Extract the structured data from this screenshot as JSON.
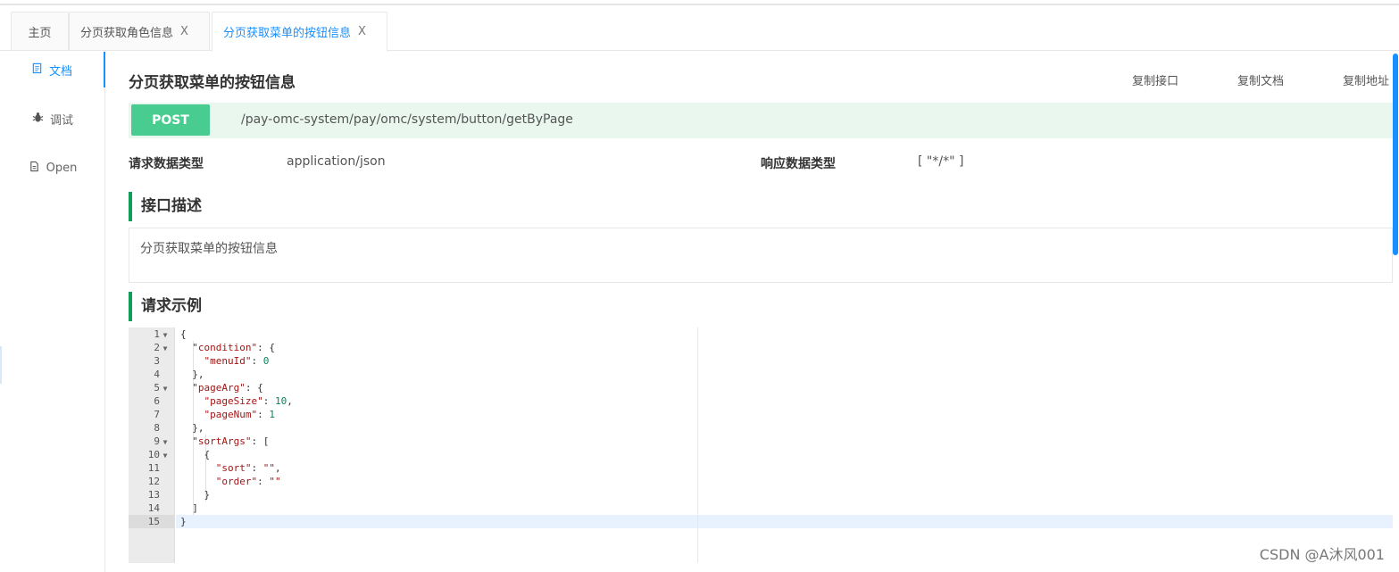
{
  "tabs": [
    {
      "label": "主页",
      "closable": false,
      "active": false
    },
    {
      "label": "分页获取角色信息",
      "closable": true,
      "active": false
    },
    {
      "label": "分页获取菜单的按钮信息",
      "closable": true,
      "active": true
    }
  ],
  "tab_close_glyph": "X",
  "sidebar": {
    "items": [
      {
        "label": "文档",
        "icon": "document-icon",
        "active": true
      },
      {
        "label": "调试",
        "icon": "bug-icon",
        "active": false
      },
      {
        "label": "Open",
        "icon": "file-icon",
        "active": false
      }
    ]
  },
  "api": {
    "title": "分页获取菜单的按钮信息",
    "actions": [
      "复制接口",
      "复制文档",
      "复制地址"
    ],
    "method": "POST",
    "path": "/pay-omc-system/pay/omc/system/button/getByPage",
    "request_type_label": "请求数据类型",
    "request_type_value": "application/json",
    "response_type_label": "响应数据类型",
    "response_type_value": "[ \"*/*\" ]"
  },
  "description": {
    "heading": "接口描述",
    "text": "分页获取菜单的按钮信息"
  },
  "example": {
    "heading": "请求示例",
    "active_line": 15,
    "lines": [
      "{",
      "  \"condition\": {",
      "    \"menuId\": 0",
      "  },",
      "  \"pageArg\": {",
      "    \"pageSize\": 10,",
      "    \"pageNum\": 1",
      "  },",
      "  \"sortArgs\": [",
      "    {",
      "      \"sort\": \"\",",
      "      \"order\": \"\"",
      "    }",
      "  ]",
      "}"
    ],
    "foldable_lines": [
      1,
      2,
      5,
      9,
      10
    ]
  },
  "colors": {
    "accent": "#1890ff",
    "post": "#49cc90",
    "url_bg": "#e9f7ef",
    "section_bar": "#0f9d58"
  },
  "watermark": "CSDN @A沐风001"
}
